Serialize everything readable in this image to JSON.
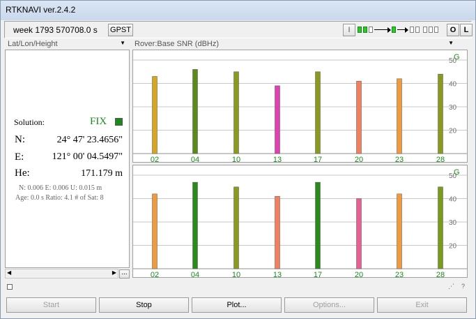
{
  "app": {
    "title": "RTKNAVI ver.2.4.2"
  },
  "toolbar": {
    "time_text": "week 1793 570708.0 s",
    "time_system": "GPST",
    "i_label": "I",
    "o_label": "O",
    "l_label": "L"
  },
  "left_combo": {
    "value": "Lat/Lon/Height"
  },
  "right_combo": {
    "value": "Rover:Base SNR (dBHz)"
  },
  "solution": {
    "label": "Solution:",
    "status": "FIX",
    "status_color": "#1a8a1a",
    "n_label": "N:",
    "n_value": "24° 47' 23.4656\"",
    "e_label": "E:",
    "e_value": "121° 00' 04.5497\"",
    "h_label": "He:",
    "h_value": "171.179 m",
    "std_line": "N: 0.006 E: 0.006 U: 0.015 m",
    "age_line": "Age: 0.0 s Ratio: 4.1 # of Sat: 8"
  },
  "chart_data": [
    {
      "type": "bar",
      "system_label": "G",
      "categories": [
        "02",
        "04",
        "10",
        "13",
        "17",
        "20",
        "23",
        "28"
      ],
      "values": [
        43,
        46,
        45,
        39,
        45,
        41,
        42,
        44
      ],
      "colors": [
        "#d7a520",
        "#5a8a1a",
        "#8a9a1e",
        "#e040b0",
        "#8a9a1e",
        "#f08060",
        "#f09a40",
        "#8a9a1e"
      ],
      "ylim": [
        10,
        53
      ],
      "yticks": [
        20,
        30,
        40,
        50
      ]
    },
    {
      "type": "bar",
      "system_label": "G",
      "categories": [
        "02",
        "04",
        "10",
        "13",
        "17",
        "20",
        "23",
        "28"
      ],
      "values": [
        42,
        47,
        45,
        41,
        47,
        40,
        42,
        45
      ],
      "colors": [
        "#f09a40",
        "#2a8a1a",
        "#8a9a1e",
        "#f08060",
        "#2a8a1a",
        "#e86090",
        "#f09a40",
        "#7a9a1e"
      ],
      "ylim": [
        10,
        53
      ],
      "yticks": [
        20,
        30,
        40,
        50
      ]
    }
  ],
  "buttons": {
    "start": "Start",
    "stop": "Stop",
    "plot": "Plot...",
    "options": "Options...",
    "exit": "Exit"
  },
  "status": {
    "help": "?"
  },
  "misc": {
    "ellipsis": "..."
  }
}
